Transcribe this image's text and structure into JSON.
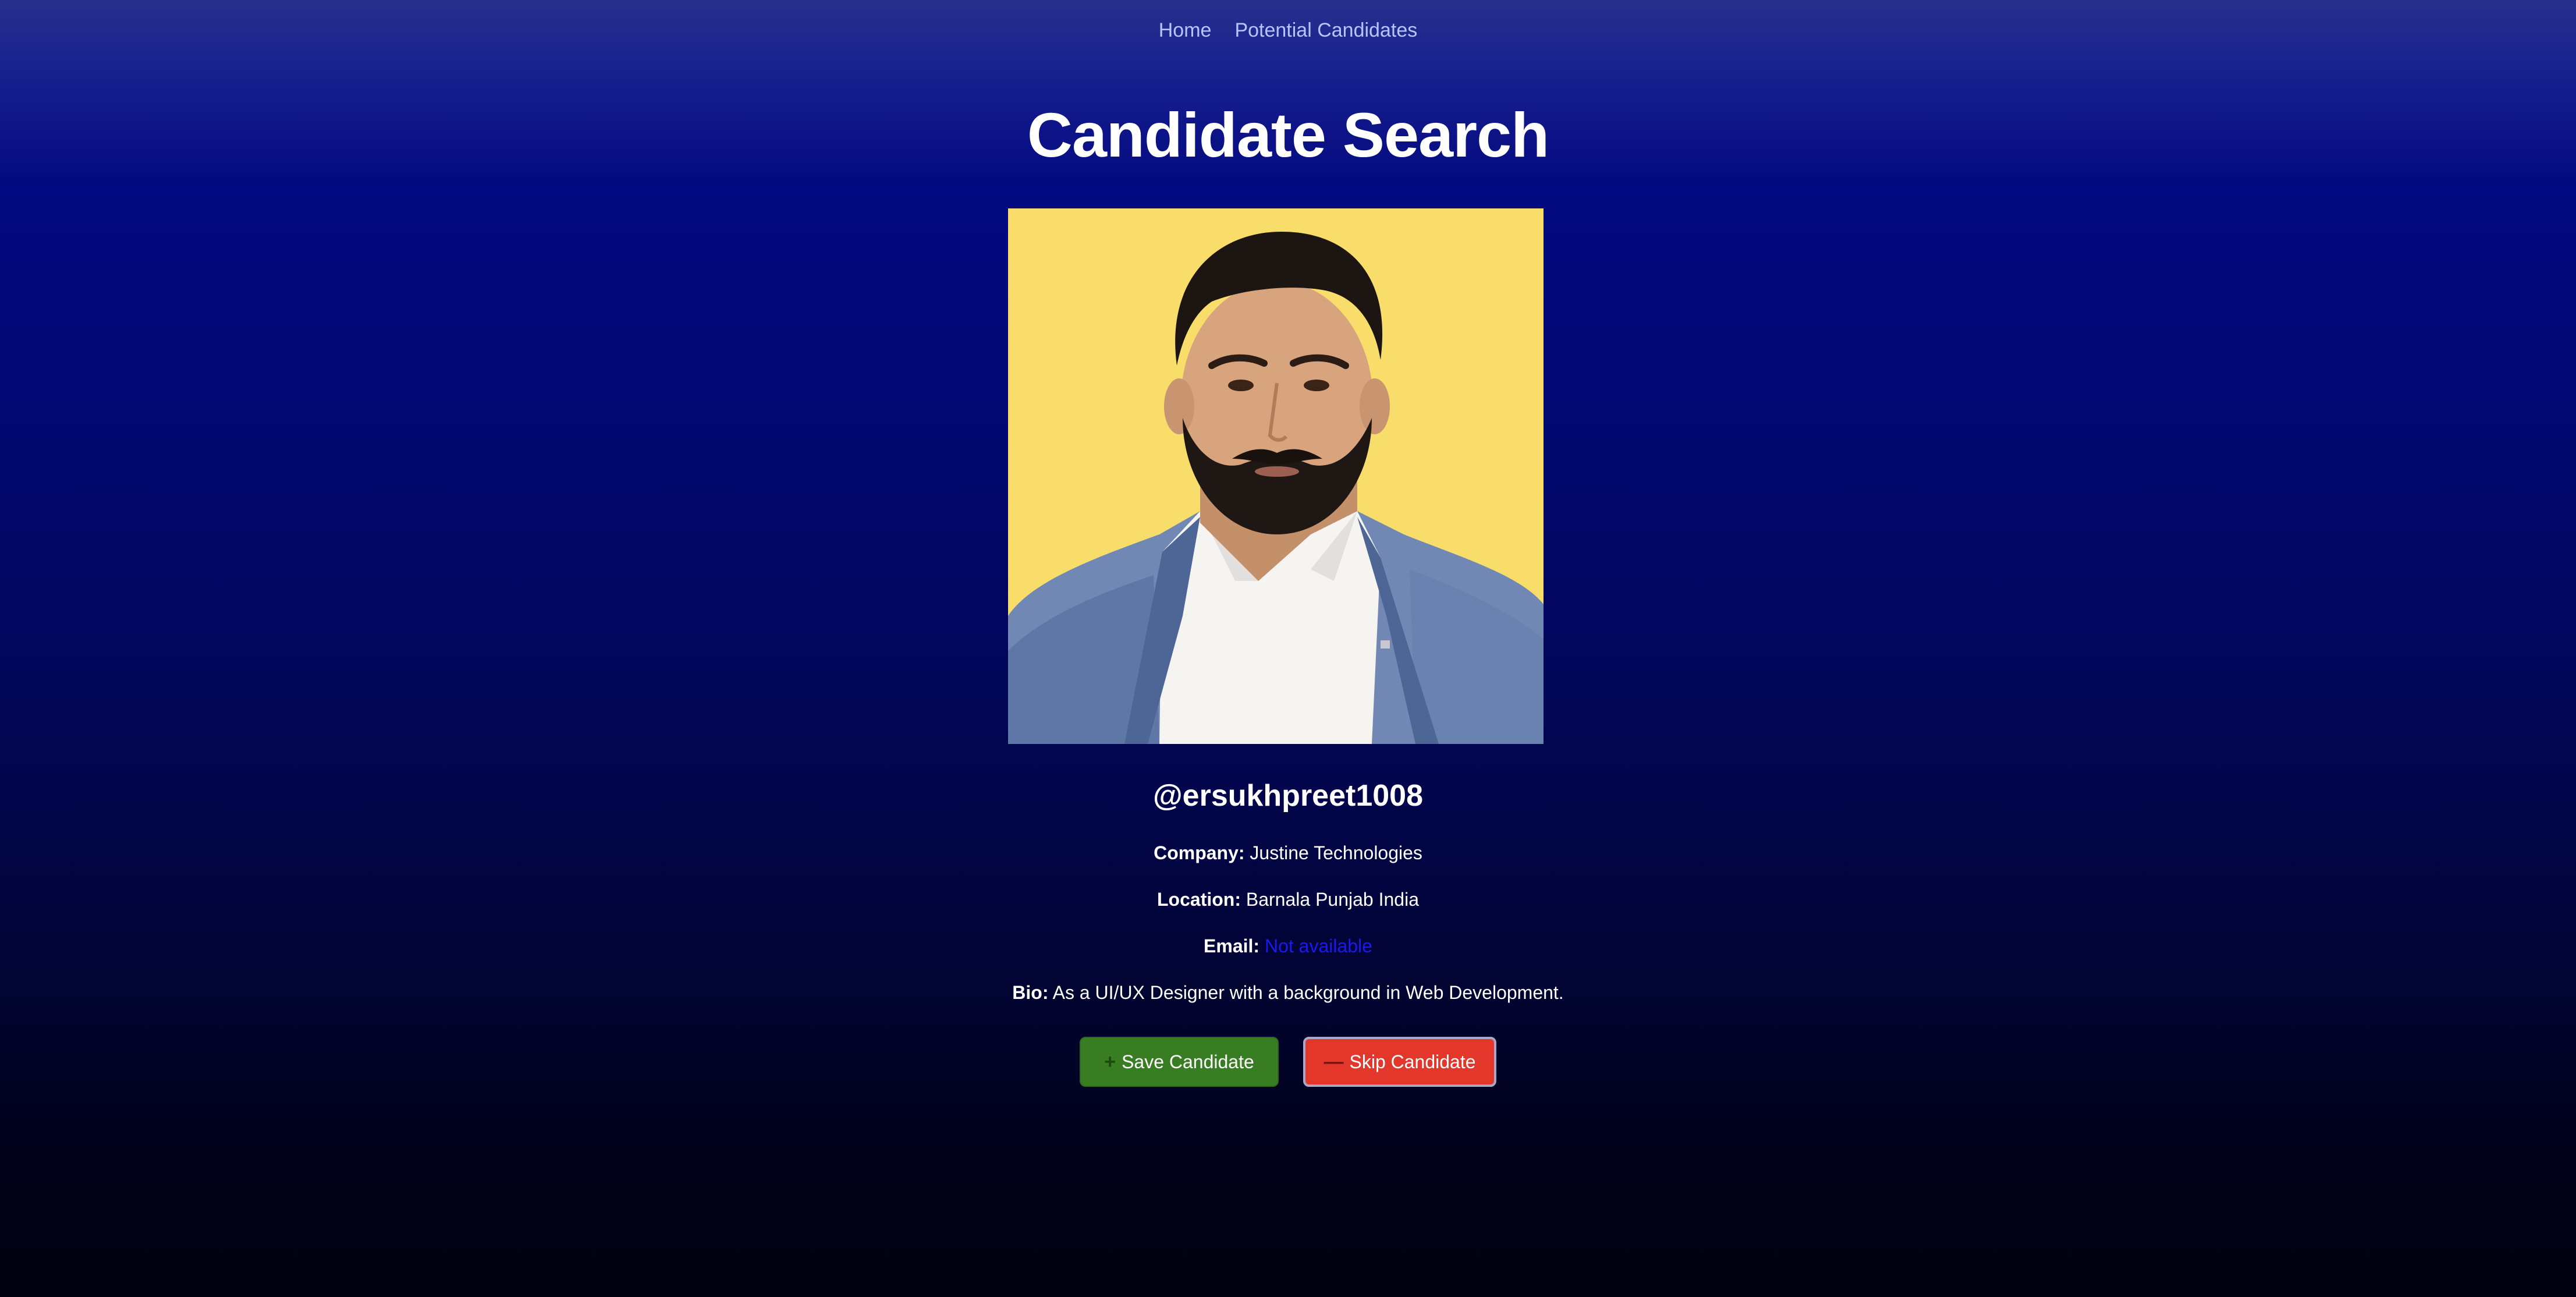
{
  "nav": {
    "home": "Home",
    "potential_candidates": "Potential Candidates"
  },
  "page": {
    "title": "Candidate Search"
  },
  "candidate": {
    "username": "@ersukhpreet1008",
    "company_label": "Company:",
    "company": "Justine Technologies",
    "location_label": "Location:",
    "location": "Barnala Punjab India",
    "email_label": "Email:",
    "email": "Not available",
    "bio_label": "Bio:",
    "bio": "As a UI/UX Designer with a background in Web Development."
  },
  "actions": {
    "save_icon": "plus-icon",
    "save_label": "Save Candidate",
    "skip_icon": "minus-icon",
    "skip_label": "Skip Candidate"
  },
  "colors": {
    "save_button": "#387d22",
    "skip_button": "#e3372b",
    "email_link": "#1a1aee",
    "photo_background": "#f9dd6a"
  }
}
